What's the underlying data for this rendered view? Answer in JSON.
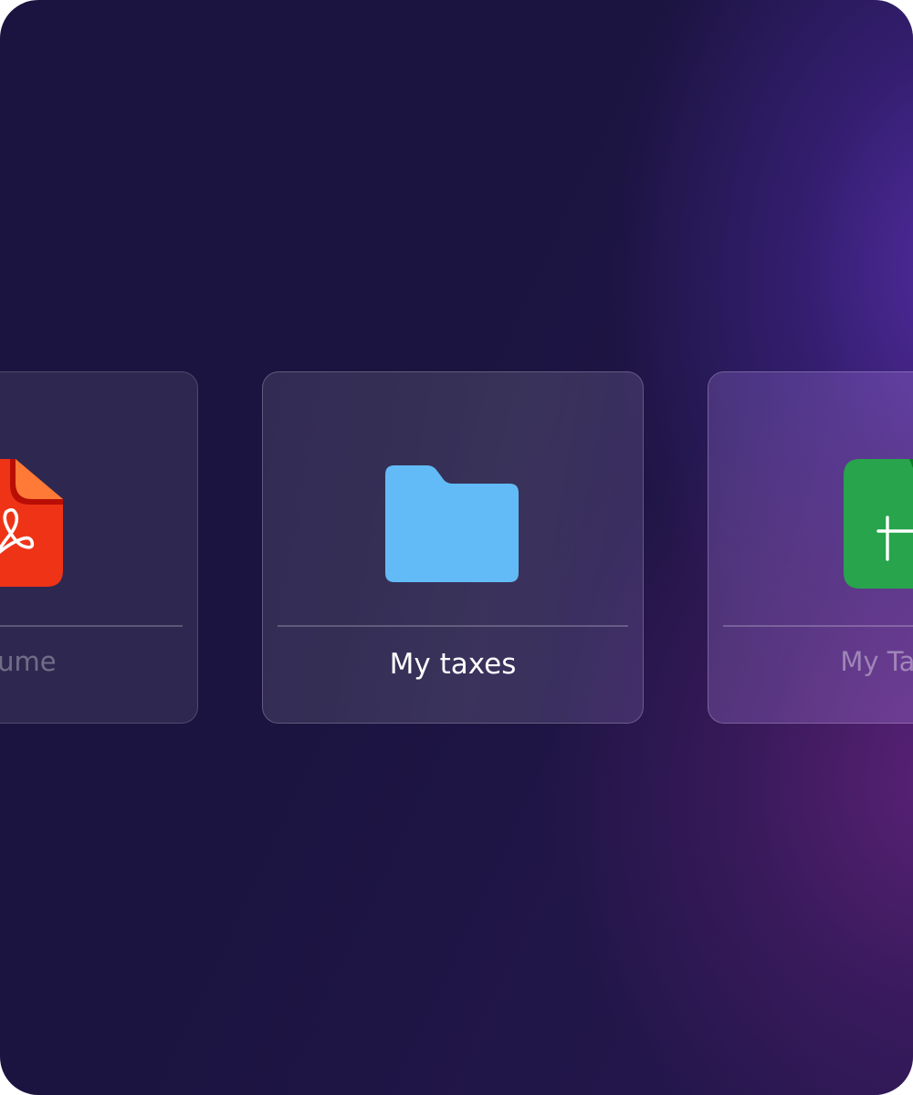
{
  "files": [
    {
      "label": "Resume",
      "type": "pdf",
      "icon": "pdf-icon",
      "position": "left-partial",
      "colors": {
        "body": "#ef3317",
        "fold": "#ff7a36",
        "fold_edge": "#b90e06",
        "glyph": "#ffffff"
      }
    },
    {
      "label": "My taxes",
      "type": "folder",
      "icon": "folder-icon",
      "position": "center-focused",
      "colors": {
        "body": "#62bbf6"
      }
    },
    {
      "label": "My Taxes",
      "type": "spreadsheet",
      "icon": "spreadsheet-icon",
      "position": "right-partial",
      "colors": {
        "body": "#28a44c",
        "fold": "#0e7a27",
        "glyph": "#ffffff"
      }
    }
  ],
  "theme": {
    "background": "#1b1440",
    "glow_top": "#5f35bd",
    "glow_bottom": "#7f2a8c"
  }
}
